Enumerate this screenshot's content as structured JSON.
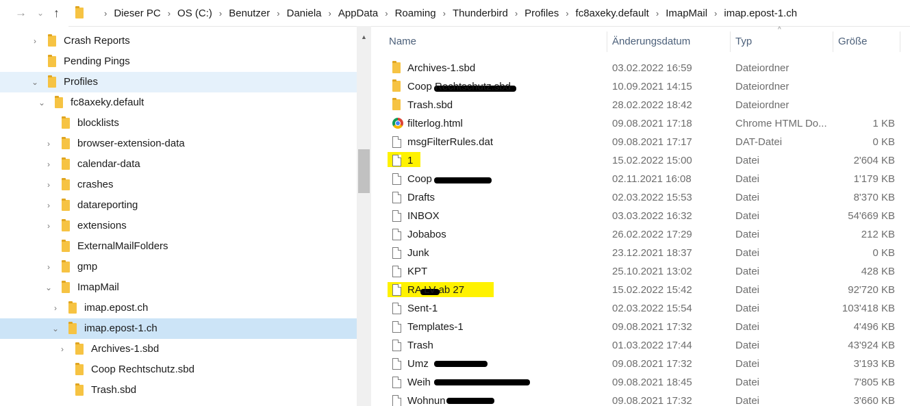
{
  "address_bar": {
    "crumbs": [
      "Dieser PC",
      "OS (C:)",
      "Benutzer",
      "Daniela",
      "AppData",
      "Roaming",
      "Thunderbird",
      "Profiles",
      "fc8axeky.default",
      "ImapMail",
      "imap.epost-1.ch"
    ]
  },
  "nav_tree": [
    {
      "label": "Crash Reports",
      "expand": "collapsed",
      "state": ""
    },
    {
      "label": "Pending Pings",
      "expand": "none",
      "state": ""
    },
    {
      "label": "Profiles",
      "expand": "expanded",
      "state": "hover"
    },
    {
      "label": "fc8axeky.default",
      "expand": "expanded",
      "state": ""
    },
    {
      "label": "blocklists",
      "expand": "none",
      "state": ""
    },
    {
      "label": "browser-extension-data",
      "expand": "collapsed",
      "state": ""
    },
    {
      "label": "calendar-data",
      "expand": "collapsed",
      "state": ""
    },
    {
      "label": "crashes",
      "expand": "collapsed",
      "state": ""
    },
    {
      "label": "datareporting",
      "expand": "collapsed",
      "state": ""
    },
    {
      "label": "extensions",
      "expand": "collapsed",
      "state": ""
    },
    {
      "label": "ExternalMailFolders",
      "expand": "none",
      "state": ""
    },
    {
      "label": "gmp",
      "expand": "collapsed",
      "state": ""
    },
    {
      "label": "ImapMail",
      "expand": "expanded",
      "state": ""
    },
    {
      "label": "imap.epost.ch",
      "expand": "collapsed",
      "state": ""
    },
    {
      "label": "imap.epost-1.ch",
      "expand": "expanded",
      "state": "selected"
    },
    {
      "label": "Archives-1.sbd",
      "expand": "collapsed",
      "state": ""
    },
    {
      "label": "Coop Rechtschutz.sbd",
      "expand": "none",
      "state": ""
    },
    {
      "label": "Trash.sbd",
      "expand": "none",
      "state": ""
    }
  ],
  "columns": {
    "name": "Name",
    "date": "Änderungsdatum",
    "type": "Typ",
    "size": "Größe"
  },
  "files": [
    {
      "name": "Archives-1.sbd",
      "date": "03.02.2022 16:59",
      "type": "Dateiordner",
      "size": "",
      "icon": "folder-icon"
    },
    {
      "name": "Coop Rechtschutz.sbd",
      "date": "10.09.2021 14:15",
      "type": "Dateiordner",
      "size": "",
      "icon": "folder-icon"
    },
    {
      "name": "Trash.sbd",
      "date": "28.02.2022 18:42",
      "type": "Dateiordner",
      "size": "",
      "icon": "folder-icon"
    },
    {
      "name": "filterlog.html",
      "date": "09.08.2021 17:18",
      "type": "Chrome HTML Do...",
      "size": "1 KB",
      "icon": "chrome-icon"
    },
    {
      "name": "msgFilterRules.dat",
      "date": "09.08.2021 17:17",
      "type": "DAT-Datei",
      "size": "0 KB",
      "icon": "file-icon"
    },
    {
      "name": "1",
      "date": "15.02.2022 15:00",
      "type": "Datei",
      "size": "2'604 KB",
      "icon": "file-icon"
    },
    {
      "name": "Coop",
      "date": "02.11.2021 16:08",
      "type": "Datei",
      "size": "1'179 KB",
      "icon": "file-icon"
    },
    {
      "name": "Drafts",
      "date": "02.03.2022 15:53",
      "type": "Datei",
      "size": "8'370 KB",
      "icon": "file-icon"
    },
    {
      "name": "INBOX",
      "date": "03.03.2022 16:32",
      "type": "Datei",
      "size": "54'669 KB",
      "icon": "file-icon"
    },
    {
      "name": "Jobabos",
      "date": "26.02.2022 17:29",
      "type": "Datei",
      "size": "212 KB",
      "icon": "file-icon"
    },
    {
      "name": "Junk",
      "date": "23.12.2021 18:37",
      "type": "Datei",
      "size": "0 KB",
      "icon": "file-icon"
    },
    {
      "name": "KPT",
      "date": "25.10.2021 13:02",
      "type": "Datei",
      "size": "428 KB",
      "icon": "file-icon"
    },
    {
      "name": "RA     LV ab 27",
      "date": "15.02.2022 15:42",
      "type": "Datei",
      "size": "92'720 KB",
      "icon": "file-icon"
    },
    {
      "name": "Sent-1",
      "date": "02.03.2022 15:54",
      "type": "Datei",
      "size": "103'418 KB",
      "icon": "file-icon"
    },
    {
      "name": "Templates-1",
      "date": "09.08.2021 17:32",
      "type": "Datei",
      "size": "4'496 KB",
      "icon": "file-icon"
    },
    {
      "name": "Trash",
      "date": "01.03.2022 17:44",
      "type": "Datei",
      "size": "43'924 KB",
      "icon": "file-icon"
    },
    {
      "name": "Umz",
      "date": "09.08.2021 17:32",
      "type": "Datei",
      "size": "3'193 KB",
      "icon": "file-icon"
    },
    {
      "name": "Weih",
      "date": "09.08.2021 18:45",
      "type": "Datei",
      "size": "7'805 KB",
      "icon": "file-icon"
    },
    {
      "name": "Wohnun",
      "date": "09.08.2021 17:32",
      "type": "Datei",
      "size": "3'660 KB",
      "icon": "file-icon"
    }
  ]
}
